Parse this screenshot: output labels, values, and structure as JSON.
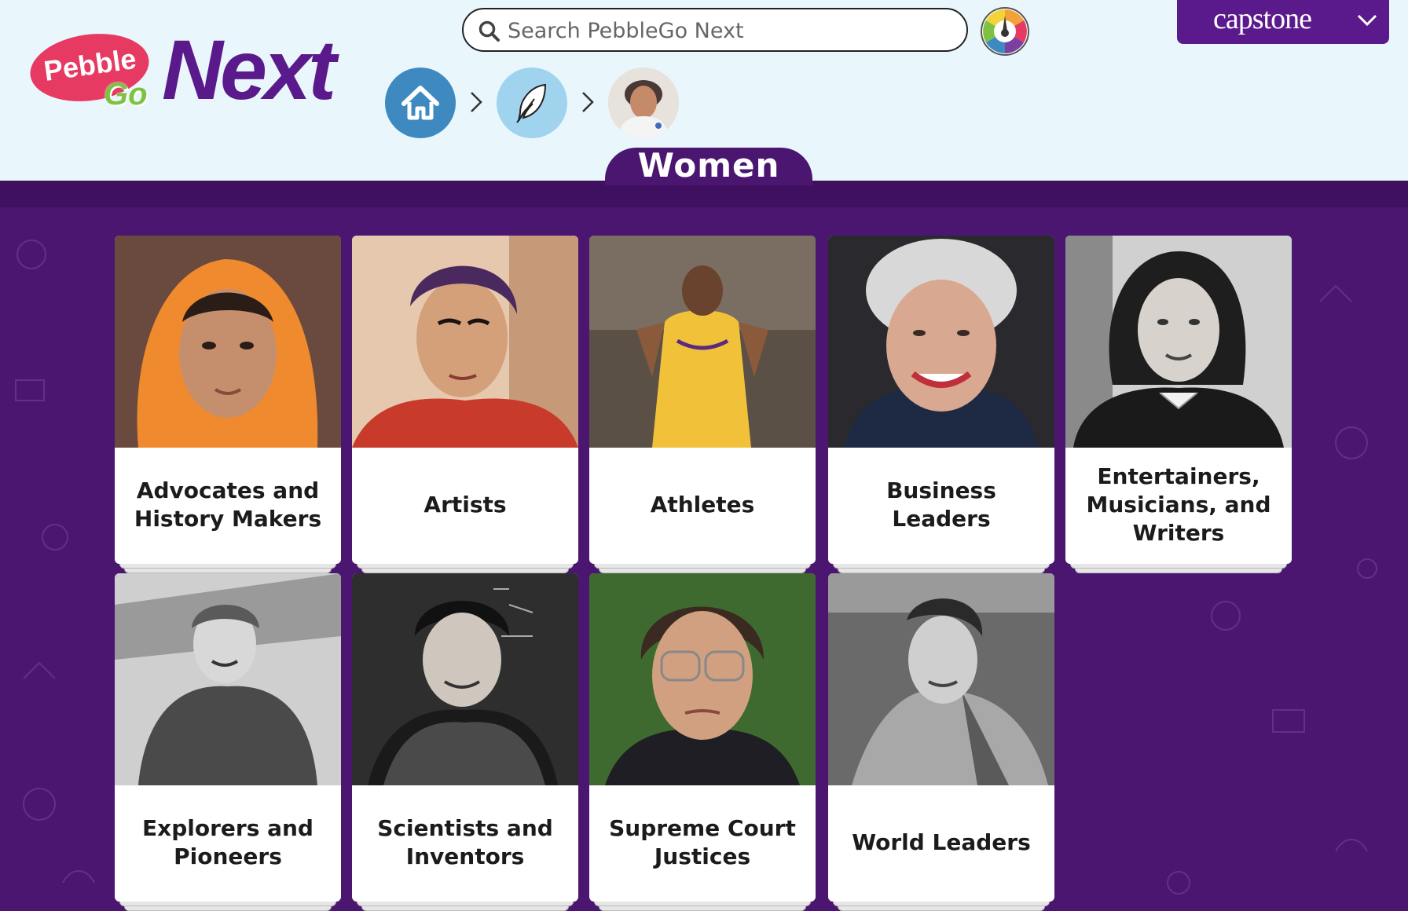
{
  "search": {
    "placeholder": "Search PebbleGo Next"
  },
  "brand": {
    "logo_pebble": "Pebble",
    "logo_go": "Go",
    "logo_next": "Next",
    "publisher": "capstone"
  },
  "breadcrumb": [
    {
      "icon": "home-icon"
    },
    {
      "icon": "quill-feather-icon"
    },
    {
      "icon": "portrait-photo"
    }
  ],
  "page": {
    "title": "Women"
  },
  "colors": {
    "header_bg": "#e9f6fc",
    "brand_purple": "#5b1a8b",
    "page_bg": "#4b1670",
    "home_button": "#3e8ac0",
    "category_button": "#9fd3ee"
  },
  "categories": [
    {
      "label": "Advocates and History Makers"
    },
    {
      "label": "Artists"
    },
    {
      "label": "Athletes"
    },
    {
      "label": "Business Leaders"
    },
    {
      "label": "Entertainers, Musicians, and Writers"
    },
    {
      "label": "Explorers and Pioneers"
    },
    {
      "label": "Scientists and Inventors"
    },
    {
      "label": "Supreme Court Justices"
    },
    {
      "label": "World Leaders"
    }
  ]
}
